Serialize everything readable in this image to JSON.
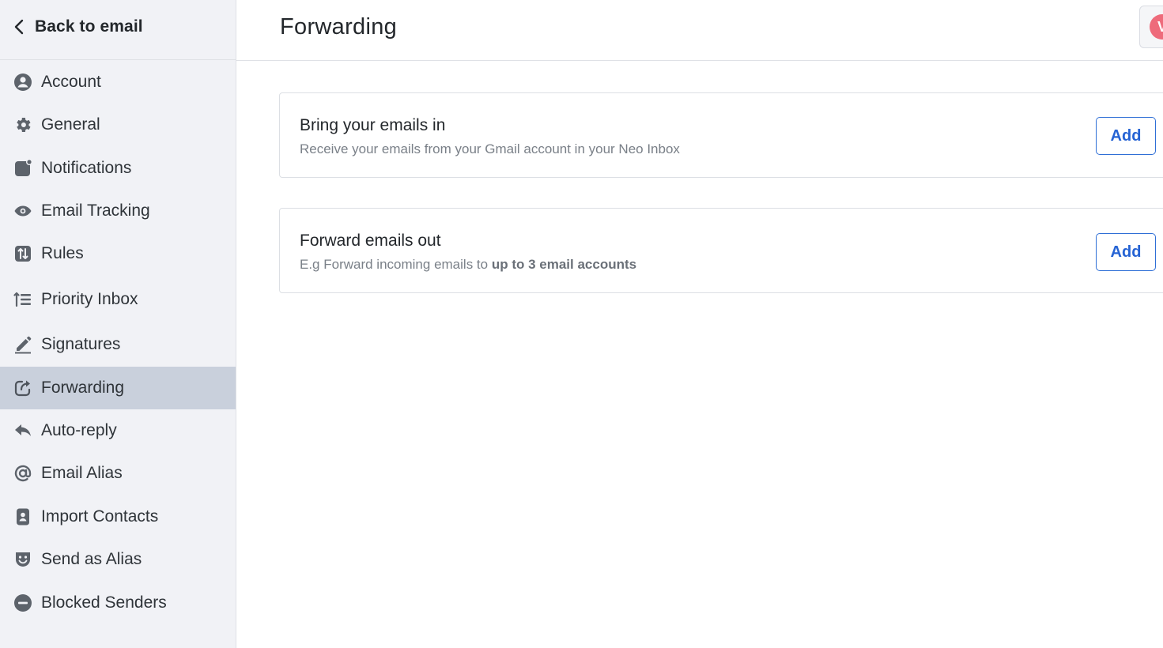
{
  "sidebar": {
    "back_label": "Back to email",
    "items": [
      {
        "label": "Account",
        "icon": "account-circle-icon",
        "active": false
      },
      {
        "label": "General",
        "icon": "gear-icon",
        "active": false
      },
      {
        "label": "Notifications",
        "icon": "notification-badge-icon",
        "active": false
      },
      {
        "label": "Email Tracking",
        "icon": "eye-icon",
        "active": false
      },
      {
        "label": "Rules",
        "icon": "rules-sort-icon",
        "active": false
      },
      {
        "label": "Priority Inbox",
        "icon": "priority-list-icon",
        "active": false
      },
      {
        "label": "Signatures",
        "icon": "pen-icon",
        "active": false
      },
      {
        "label": "Forwarding",
        "icon": "forward-share-icon",
        "active": true
      },
      {
        "label": "Auto-reply",
        "icon": "reply-arrow-icon",
        "active": false
      },
      {
        "label": "Email Alias",
        "icon": "at-sign-icon",
        "active": false
      },
      {
        "label": "Import Contacts",
        "icon": "contact-card-icon",
        "active": false
      },
      {
        "label": "Send as Alias",
        "icon": "mask-icon",
        "active": false
      },
      {
        "label": "Blocked Senders",
        "icon": "block-icon",
        "active": false
      }
    ]
  },
  "header": {
    "title": "Forwarding",
    "avatar_initial": "V",
    "avatar_color": "#ee6b7b"
  },
  "cards": [
    {
      "title": "Bring your emails in",
      "description": "Receive your emails from your Gmail account in your Neo Inbox",
      "button_label": "Add"
    },
    {
      "title": "Forward emails out",
      "description_prefix": "E.g Forward incoming emails to ",
      "description_bold": "up to 3 email accounts",
      "button_label": "Add"
    }
  ],
  "colors": {
    "sidebar_bg": "#f1f2f6",
    "active_item_bg": "#c9d0dc",
    "accent_blue": "#2563d4"
  }
}
